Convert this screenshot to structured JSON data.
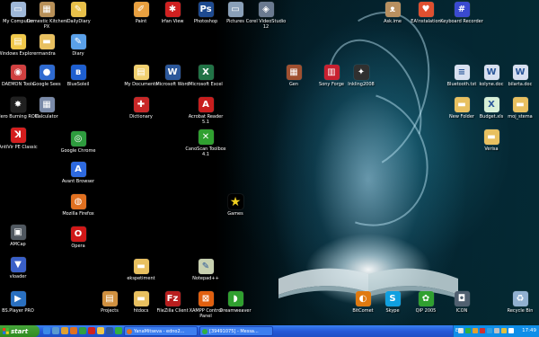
{
  "desktop_icons": [
    {
      "label": "My Computer",
      "icon": "computer-icon",
      "color": "#9fb8d8",
      "glyph": "▭"
    },
    {
      "label": "Domestic Kitchen PX",
      "icon": "kitchen-icon",
      "color": "#b89058",
      "glyph": "▦"
    },
    {
      "label": "iDailyDiary",
      "icon": "diary-icon",
      "color": "#e8c04a",
      "glyph": "✎"
    },
    {
      "label": "Windows Explorer",
      "icon": "explorer-icon",
      "color": "#f0c84a",
      "glyph": "▤"
    },
    {
      "label": "mandra",
      "icon": "folder-icon",
      "color": "#e8c060",
      "glyph": "▬"
    },
    {
      "label": "Diary",
      "icon": "diary-icon",
      "color": "#5aa0e8",
      "glyph": "✎"
    },
    {
      "label": "DAEMON Tools",
      "icon": "daemon-icon",
      "color": "#d04040",
      "glyph": "◉"
    },
    {
      "label": "Google Sees",
      "icon": "google-earth-icon",
      "color": "#2e6ad0",
      "glyph": "●"
    },
    {
      "label": "BlueSoleil",
      "icon": "bluetooth-icon",
      "color": "#1e5fd0",
      "glyph": "ʙ"
    },
    {
      "label": "Nero Burning ROM",
      "icon": "nero-icon",
      "color": "#202020",
      "glyph": "✸"
    },
    {
      "label": "Calculator",
      "icon": "calculator-icon",
      "color": "#7a8aa8",
      "glyph": "▦"
    },
    {
      "label": "AntiVir PE Classic",
      "icon": "antivir-icon",
      "color": "#d41e1e",
      "glyph": "ꓘ"
    },
    {
      "label": "Google Chrome",
      "icon": "chrome-icon",
      "color": "#2e9c3e",
      "glyph": "◎"
    },
    {
      "label": "Avant Browser",
      "icon": "avant-icon",
      "color": "#2e6ae0",
      "glyph": "A"
    },
    {
      "label": "Mozilla Firefox",
      "icon": "firefox-icon",
      "color": "#e07020",
      "glyph": "◍"
    },
    {
      "label": "AMCap",
      "icon": "camera-icon",
      "color": "#505860",
      "glyph": "▣"
    },
    {
      "label": "Opera",
      "icon": "opera-icon",
      "color": "#d01818",
      "glyph": "O"
    },
    {
      "label": "vloader",
      "icon": "vloader-icon",
      "color": "#3a60c8",
      "glyph": "▼"
    },
    {
      "label": "BS.Player PRO",
      "icon": "bsplayer-icon",
      "color": "#2a70c0",
      "glyph": "▶"
    },
    {
      "label": "Projects",
      "icon": "projects-icon",
      "color": "#d09040",
      "glyph": "▤"
    },
    {
      "label": "Paint",
      "icon": "paint-icon",
      "color": "#e8a040",
      "glyph": "✐"
    },
    {
      "label": "Irfan View",
      "icon": "irfanview-icon",
      "color": "#d02020",
      "glyph": "✱"
    },
    {
      "label": "Photoshop",
      "icon": "photoshop-icon",
      "color": "#1e4a90",
      "glyph": "Ps"
    },
    {
      "label": "Pictures",
      "icon": "pictures-folder-icon",
      "color": "#8aa0b8",
      "glyph": "▭"
    },
    {
      "label": "Corel VideoStudio 12",
      "icon": "corel-icon",
      "color": "#6a7a90",
      "glyph": "◈"
    },
    {
      "label": "My Documents",
      "icon": "documents-folder-icon",
      "color": "#f0d070",
      "glyph": "▤"
    },
    {
      "label": "Microsoft Word",
      "icon": "word-icon",
      "color": "#2b579a",
      "glyph": "W"
    },
    {
      "label": "Microsoft Excel",
      "icon": "excel-icon",
      "color": "#217346",
      "glyph": "X"
    },
    {
      "label": "Dictionary",
      "icon": "dictionary-icon",
      "color": "#c82828",
      "glyph": "✚"
    },
    {
      "label": "Acrobat Reader 5.1",
      "icon": "acrobat-icon",
      "color": "#c81e1e",
      "glyph": "A"
    },
    {
      "label": "CanoScan Toolbox 4.1",
      "icon": "canoscan-icon",
      "color": "#30a030",
      "glyph": "✕"
    },
    {
      "label": "Games",
      "icon": "games-icon",
      "color": "#000000",
      "glyph": "★"
    },
    {
      "label": "ekspetiment",
      "icon": "folder-icon",
      "color": "#e8c060",
      "glyph": "▬"
    },
    {
      "label": "Notepad++",
      "icon": "notepad-icon",
      "color": "#c8d0b0",
      "glyph": "✎"
    },
    {
      "label": "htdocs",
      "icon": "folder-icon",
      "color": "#e8c060",
      "glyph": "▬"
    },
    {
      "label": "FileZilla Client",
      "icon": "filezilla-icon",
      "color": "#b81e1e",
      "glyph": "Fz"
    },
    {
      "label": "XAMPP Control Panel",
      "icon": "xampp-icon",
      "color": "#e06010",
      "glyph": "⊠"
    },
    {
      "label": "Dreamweaver",
      "icon": "dreamweaver-icon",
      "color": "#30a030",
      "glyph": "◗"
    },
    {
      "label": "Ask.ime",
      "icon": "cat-icon",
      "color": "#b89060",
      "glyph": "ᴥ"
    },
    {
      "label": "EA!nstalation",
      "icon": "ea-heart-icon",
      "color": "#e05030",
      "glyph": "♥"
    },
    {
      "label": "Keyboard Recorder",
      "icon": "keyboard-icon",
      "color": "#3a4ad0",
      "glyph": "#"
    },
    {
      "label": "Gen",
      "icon": "gen-icon",
      "color": "#a05030",
      "glyph": "▦"
    },
    {
      "label": "Sony Forge",
      "icon": "forge-icon",
      "color": "#c82030",
      "glyph": "▥"
    },
    {
      "label": "Inkling2008",
      "icon": "inkling-icon",
      "color": "#303030",
      "glyph": "✦"
    },
    {
      "label": "Bluetooth.txt",
      "icon": "text-file-icon",
      "color": "#d8e0f0",
      "glyph": "≡"
    },
    {
      "label": "kolyne.doc",
      "icon": "word-doc-icon",
      "color": "#d8e0f0",
      "glyph": "W"
    },
    {
      "label": "bilarta.doc",
      "icon": "word-doc-icon",
      "color": "#d8e0f0",
      "glyph": "W"
    },
    {
      "label": "New Folder",
      "icon": "folder-icon",
      "color": "#e8c060",
      "glyph": "▬"
    },
    {
      "label": "Budget.xls",
      "icon": "excel-doc-icon",
      "color": "#d8f0d8",
      "glyph": "X"
    },
    {
      "label": "moj_stema",
      "icon": "folder-icon",
      "color": "#e8c060",
      "glyph": "▬"
    },
    {
      "label": "Verisa",
      "icon": "folder-icon",
      "color": "#e8c060",
      "glyph": "▬"
    },
    {
      "label": "BitComet",
      "icon": "bitcomet-icon",
      "color": "#e07a10",
      "glyph": "◐"
    },
    {
      "label": "Skype",
      "icon": "skype-icon",
      "color": "#10a0e0",
      "glyph": "S"
    },
    {
      "label": "QIP 2005",
      "icon": "qip-icon",
      "color": "#30a030",
      "glyph": "✿"
    },
    {
      "label": "ICON",
      "icon": "icon-app-icon",
      "color": "#506070",
      "glyph": "◘"
    },
    {
      "label": "Recycle Bin",
      "icon": "recycle-bin-icon",
      "color": "#90b0d0",
      "glyph": "♻"
    }
  ],
  "taskbar": {
    "start_label": "start",
    "quick_launch": [
      {
        "icon": "ie-icon",
        "color": "#3a8ae8"
      },
      {
        "icon": "desktop-icon",
        "color": "#5a9ad0"
      },
      {
        "icon": "media-player-icon",
        "color": "#e0a030"
      },
      {
        "icon": "firefox-icon",
        "color": "#e07020"
      },
      {
        "icon": "chrome-icon",
        "color": "#30a040"
      },
      {
        "icon": "opera-icon",
        "color": "#d02020"
      },
      {
        "icon": "explorer-icon",
        "color": "#f0c84a"
      },
      {
        "icon": "word-icon",
        "color": "#2b579a"
      },
      {
        "icon": "messenger-icon",
        "color": "#30b040"
      }
    ],
    "tasks": [
      {
        "label": "YanaMitseva - edno2...",
        "icon": "firefox-icon",
        "color": "#e07020"
      },
      {
        "label": "[39491075] - Messa...",
        "icon": "messenger-icon",
        "color": "#30b040"
      }
    ],
    "language": "EN",
    "tray_icons": [
      {
        "icon": "tray-icon-1",
        "color": "#e0e0e0"
      },
      {
        "icon": "tray-icon-2",
        "color": "#30b040"
      },
      {
        "icon": "tray-icon-3",
        "color": "#e0a030"
      },
      {
        "icon": "tray-icon-4",
        "color": "#d03030"
      },
      {
        "icon": "tray-icon-5",
        "color": "#30a0e0"
      },
      {
        "icon": "tray-icon-6",
        "color": "#c0c0c0"
      },
      {
        "icon": "tray-icon-7",
        "color": "#e0c040"
      },
      {
        "icon": "volume-icon",
        "color": "#ffffff"
      }
    ],
    "clock": "17:49"
  }
}
